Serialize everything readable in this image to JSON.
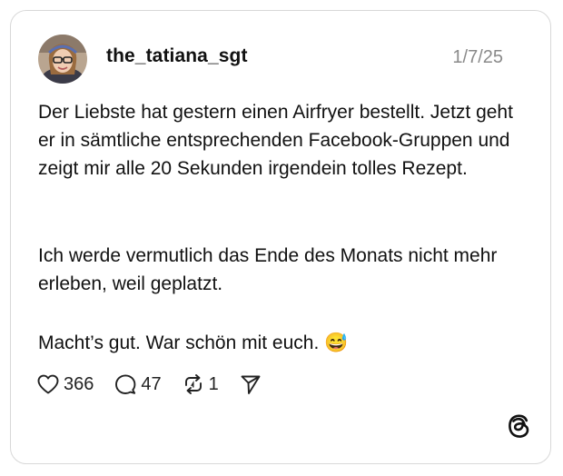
{
  "post": {
    "username": "the_tatiana_sgt",
    "date": "1/7/25",
    "paragraphs": [
      "Der Liebste hat gestern einen Airfryer bestellt. Jetzt geht er in sämtliche entsprechenden Facebook-Gruppen und zeigt mir alle 20 Sekunden irgendein tolles Rezept.",
      "Ich werde vermutlich das Ende des Monats nicht mehr erleben, weil geplatzt.",
      "Macht’s gut. War schön mit euch. 😅"
    ]
  },
  "actions": {
    "likes": "366",
    "replies": "47",
    "reposts": "1"
  },
  "icons": {
    "like": "heart-icon",
    "reply": "speech-bubble-icon",
    "repost": "repost-icon",
    "share": "send-icon",
    "brand": "threads-logo-icon"
  }
}
